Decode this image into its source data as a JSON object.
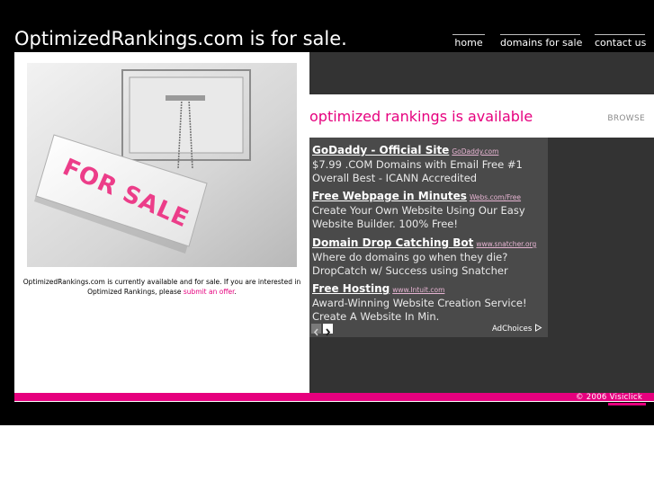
{
  "header": {
    "site_title": "OptimizedRankings.com is for sale.",
    "nav": {
      "home": "home",
      "domains_for_sale": "domains for sale",
      "contact_us": "contact us"
    }
  },
  "left": {
    "photo_sign_text": "FOR SALE",
    "caption_text": "OptimizedRankings.com is currently available and for sale. If you are interested in Optimized Rankings, please ",
    "caption_link": "submit an offer",
    "caption_end": "."
  },
  "right": {
    "heading": "optimized rankings is available",
    "browse": "BROWSE",
    "ads": [
      {
        "title": "GoDaddy - Official Site",
        "url": "GoDaddy.com",
        "desc": "$7.99 .COM Domains with Email Free #1 Overall Best - ICANN Accredited"
      },
      {
        "title": "Free Webpage in Minutes",
        "url": "Webs.com/Free",
        "desc": "Create Your Own Website Using Our Easy Website Builder. 100% Free!"
      },
      {
        "title": "Domain Drop Catching Bot",
        "url": "www.snatcher.org",
        "desc": "Where do domains go when they die? DropCatch w/ Success using Snatcher"
      },
      {
        "title": "Free Hosting",
        "url": "www.Intuit.com",
        "desc": "Award-Winning Website Creation Service! Create A Website In Min."
      }
    ],
    "adchoices": "AdChoices"
  },
  "footer": {
    "copyright": "© 2006 Visiclick"
  },
  "colors": {
    "accent": "#e6007e",
    "background": "#000000",
    "ad_panel": "#4a4a4a"
  }
}
